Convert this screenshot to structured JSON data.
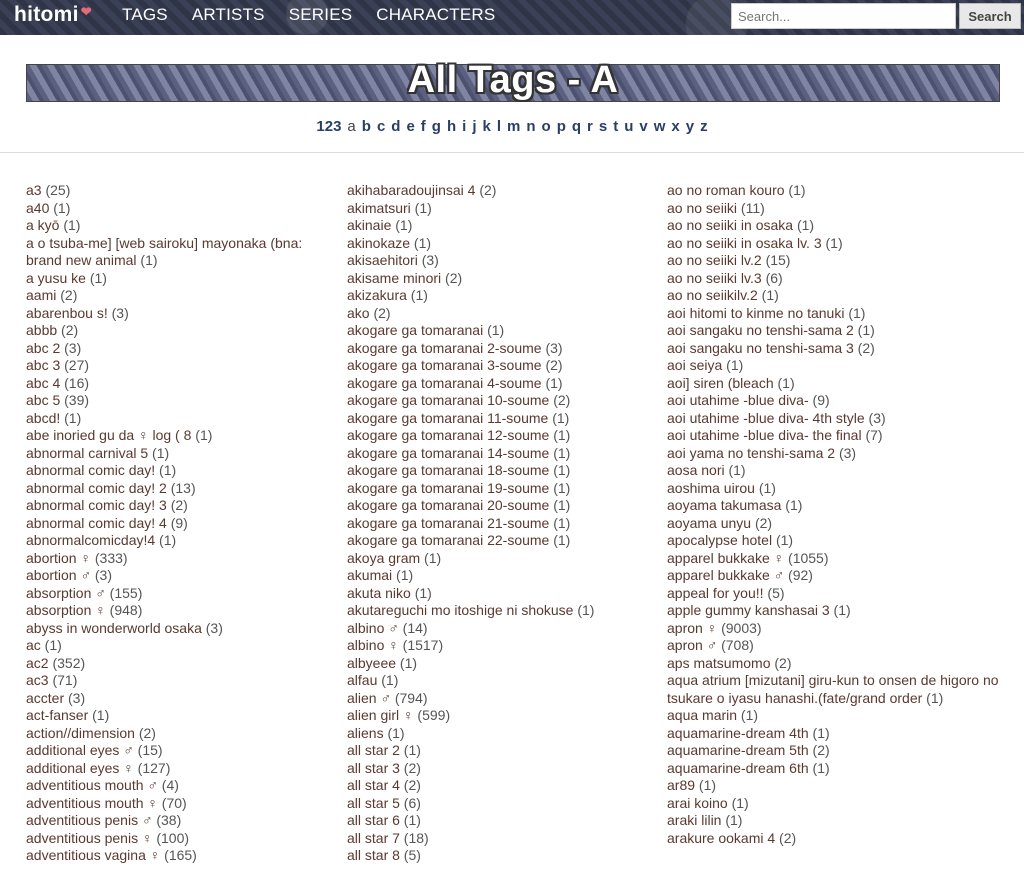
{
  "header": {
    "logo": "hitomi",
    "nav": [
      "TAGS",
      "ARTISTS",
      "SERIES",
      "CHARACTERS"
    ],
    "search_placeholder": "Search...",
    "search_button": "Search"
  },
  "banner": {
    "title": "All Tags - A"
  },
  "alphabet": {
    "current": "a",
    "items": [
      "123",
      "a",
      "b",
      "c",
      "d",
      "e",
      "f",
      "g",
      "h",
      "i",
      "j",
      "k",
      "l",
      "m",
      "n",
      "o",
      "p",
      "q",
      "r",
      "s",
      "t",
      "u",
      "v",
      "w",
      "x",
      "y",
      "z"
    ]
  },
  "columns": [
    [
      {
        "name": "a3",
        "count": "(25)"
      },
      {
        "name": "a40",
        "count": "(1)"
      },
      {
        "name": "a kyō",
        "count": "(1)"
      },
      {
        "name": "a o tsuba-me] [web sairoku] mayonaka (bna:",
        "count": ""
      },
      {
        "name": "brand new animal",
        "count": "(1)"
      },
      {
        "name": "a yusu ke",
        "count": "(1)"
      },
      {
        "name": "aami",
        "count": "(2)"
      },
      {
        "name": "abarenbou s!",
        "count": "(3)"
      },
      {
        "name": "abbb",
        "count": "(2)"
      },
      {
        "name": "abc 2",
        "count": "(3)"
      },
      {
        "name": "abc 3",
        "count": "(27)"
      },
      {
        "name": "abc 4",
        "count": "(16)"
      },
      {
        "name": "abc 5",
        "count": "(39)"
      },
      {
        "name": "abcd!",
        "count": "(1)"
      },
      {
        "name": "abe inoried gu da ♀ log ( 8",
        "count": "(1)"
      },
      {
        "name": "abnormal carnival 5",
        "count": "(1)"
      },
      {
        "name": "abnormal comic day!",
        "count": "(1)"
      },
      {
        "name": "abnormal comic day! 2",
        "count": "(13)"
      },
      {
        "name": "abnormal comic day! 3",
        "count": "(2)"
      },
      {
        "name": "abnormal comic day! 4",
        "count": "(9)"
      },
      {
        "name": "abnormalcomicday!4",
        "count": "(1)"
      },
      {
        "name": "abortion ♀",
        "count": "(333)"
      },
      {
        "name": "abortion ♂",
        "count": "(3)"
      },
      {
        "name": "absorption ♂",
        "count": "(155)"
      },
      {
        "name": "absorption ♀",
        "count": "(948)"
      },
      {
        "name": "abyss in wonderworld osaka",
        "count": "(3)"
      },
      {
        "name": "ac",
        "count": "(1)"
      },
      {
        "name": "ac2",
        "count": "(352)"
      },
      {
        "name": "ac3",
        "count": "(71)"
      },
      {
        "name": "accter",
        "count": "(3)"
      },
      {
        "name": "act-fanser",
        "count": "(1)"
      },
      {
        "name": "action//dimension",
        "count": "(2)"
      },
      {
        "name": "additional eyes ♂",
        "count": "(15)"
      },
      {
        "name": "additional eyes ♀",
        "count": "(127)"
      },
      {
        "name": "adventitious mouth ♂",
        "count": "(4)"
      },
      {
        "name": "adventitious mouth ♀",
        "count": "(70)"
      },
      {
        "name": "adventitious penis ♂",
        "count": "(38)"
      },
      {
        "name": "adventitious penis ♀",
        "count": "(100)"
      },
      {
        "name": "adventitious vagina ♀",
        "count": "(165)"
      }
    ],
    [
      {
        "name": "akihabaradoujinsai 4",
        "count": "(2)"
      },
      {
        "name": "akimatsuri",
        "count": "(1)"
      },
      {
        "name": "akinaie",
        "count": "(1)"
      },
      {
        "name": "akinokaze",
        "count": "(1)"
      },
      {
        "name": "akisaehitori",
        "count": "(3)"
      },
      {
        "name": "akisame minori",
        "count": "(2)"
      },
      {
        "name": "akizakura",
        "count": "(1)"
      },
      {
        "name": "ako",
        "count": "(2)"
      },
      {
        "name": "akogare ga tomaranai",
        "count": "(1)"
      },
      {
        "name": "akogare ga tomaranai 2-soume",
        "count": "(3)"
      },
      {
        "name": "akogare ga tomaranai 3-soume",
        "count": "(2)"
      },
      {
        "name": "akogare ga tomaranai 4-soume",
        "count": "(1)"
      },
      {
        "name": "akogare ga tomaranai 10-soume",
        "count": "(2)"
      },
      {
        "name": "akogare ga tomaranai 11-soume",
        "count": "(1)"
      },
      {
        "name": "akogare ga tomaranai 12-soume",
        "count": "(1)"
      },
      {
        "name": "akogare ga tomaranai 14-soume",
        "count": "(1)"
      },
      {
        "name": "akogare ga tomaranai 18-soume",
        "count": "(1)"
      },
      {
        "name": "akogare ga tomaranai 19-soume",
        "count": "(1)"
      },
      {
        "name": "akogare ga tomaranai 20-soume",
        "count": "(1)"
      },
      {
        "name": "akogare ga tomaranai 21-soume",
        "count": "(1)"
      },
      {
        "name": "akogare ga tomaranai 22-soume",
        "count": "(1)"
      },
      {
        "name": "akoya gram",
        "count": "(1)"
      },
      {
        "name": "akumai",
        "count": "(1)"
      },
      {
        "name": "akuta niko",
        "count": "(1)"
      },
      {
        "name": "akutareguchi mo itoshige ni shokuse",
        "count": "(1)"
      },
      {
        "name": "albino ♂",
        "count": "(14)"
      },
      {
        "name": "albino ♀",
        "count": "(1517)"
      },
      {
        "name": "albyeee",
        "count": "(1)"
      },
      {
        "name": "alfau",
        "count": "(1)"
      },
      {
        "name": "alien ♂",
        "count": "(794)"
      },
      {
        "name": "alien girl ♀",
        "count": "(599)"
      },
      {
        "name": "aliens",
        "count": "(1)"
      },
      {
        "name": "all star 2",
        "count": "(1)"
      },
      {
        "name": "all star 3",
        "count": "(2)"
      },
      {
        "name": "all star 4",
        "count": "(2)"
      },
      {
        "name": "all star 5",
        "count": "(6)"
      },
      {
        "name": "all star 6",
        "count": "(1)"
      },
      {
        "name": "all star 7",
        "count": "(18)"
      },
      {
        "name": "all star 8",
        "count": "(5)"
      }
    ],
    [
      {
        "name": "ao no roman kouro",
        "count": "(1)"
      },
      {
        "name": "ao no seiiki",
        "count": "(11)"
      },
      {
        "name": "ao no seiiki in osaka",
        "count": "(1)"
      },
      {
        "name": "ao no seiiki in osaka lv. 3",
        "count": "(1)"
      },
      {
        "name": "ao no seiiki lv.2",
        "count": "(15)"
      },
      {
        "name": "ao no seiiki lv.3",
        "count": "(6)"
      },
      {
        "name": "ao no seiikilv.2",
        "count": "(1)"
      },
      {
        "name": "aoi hitomi to kinme no tanuki",
        "count": "(1)"
      },
      {
        "name": "aoi sangaku no tenshi-sama 2",
        "count": "(1)"
      },
      {
        "name": "aoi sangaku no tenshi-sama 3",
        "count": "(2)"
      },
      {
        "name": "aoi seiya",
        "count": "(1)"
      },
      {
        "name": "aoi] siren (bleach",
        "count": "(1)"
      },
      {
        "name": "aoi utahime -blue diva-",
        "count": "(9)"
      },
      {
        "name": "aoi utahime -blue diva- 4th style",
        "count": "(3)"
      },
      {
        "name": "aoi utahime -blue diva- the final",
        "count": "(7)"
      },
      {
        "name": "aoi yama no tenshi-sama 2",
        "count": "(3)"
      },
      {
        "name": "aosa nori",
        "count": "(1)"
      },
      {
        "name": "aoshima uirou",
        "count": "(1)"
      },
      {
        "name": "aoyama takumasa",
        "count": "(1)"
      },
      {
        "name": "aoyama unyu",
        "count": "(2)"
      },
      {
        "name": "apocalypse hotel",
        "count": "(1)"
      },
      {
        "name": "apparel bukkake ♀",
        "count": "(1055)"
      },
      {
        "name": "apparel bukkake ♂",
        "count": "(92)"
      },
      {
        "name": "appeal for you!!",
        "count": "(5)"
      },
      {
        "name": "apple gummy kanshasai 3",
        "count": "(1)"
      },
      {
        "name": "apron ♀",
        "count": "(9003)"
      },
      {
        "name": "apron ♂",
        "count": "(708)"
      },
      {
        "name": "aps matsumomo",
        "count": "(2)"
      },
      {
        "name": "aqua atrium [mizutani] giru-kun to onsen de higoro no tsukare o iyasu hanashi.(fate/grand order",
        "count": "(1)"
      },
      {
        "name": "aqua marin",
        "count": "(1)"
      },
      {
        "name": "aquamarine-dream 4th",
        "count": "(1)"
      },
      {
        "name": "aquamarine-dream 5th",
        "count": "(2)"
      },
      {
        "name": "aquamarine-dream 6th",
        "count": "(1)"
      },
      {
        "name": "ar89",
        "count": "(1)"
      },
      {
        "name": "arai koino",
        "count": "(1)"
      },
      {
        "name": "araki lilin",
        "count": "(1)"
      },
      {
        "name": "arakure ookami 4",
        "count": "(2)"
      }
    ]
  ]
}
